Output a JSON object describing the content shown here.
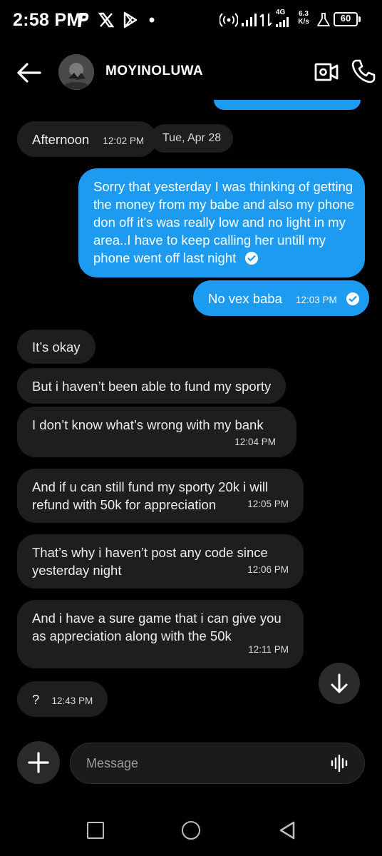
{
  "status_bar": {
    "time": "2:58 PM",
    "notification_icons": [
      "paypal-p-icon",
      "x-icon",
      "play-store-icon",
      "dot-icon"
    ],
    "network_label": "4G",
    "speed_value": "6.3",
    "speed_unit": "K/s",
    "battery": "60"
  },
  "header": {
    "contact_name": "MOYINOLUWA"
  },
  "messages": [
    {
      "text": "Afternoon",
      "time": "12:02 PM"
    },
    {
      "text": "Tue, Apr 28"
    },
    {
      "text": "Sorry that yesterday I was thinking of getting the money from my babe and also my phone don off it's was really low and no light in my area..I have to keep calling her untill my phone went off last night"
    },
    {
      "text": "No vex baba",
      "time": "12:03 PM"
    },
    {
      "text": "It’s okay"
    },
    {
      "text": "But i haven’t been able to fund my sporty"
    },
    {
      "text": "I don’t know what’s wrong with my bank",
      "time": "12:04 PM"
    },
    {
      "text": "And if u can still fund my sporty 20k i will refund with 50k for appreciation",
      "time": "12:05 PM"
    },
    {
      "text": "That’s why i haven’t post any code since yesterday night",
      "time": "12:06 PM"
    },
    {
      "text": "And i have a sure game that i can give you as appreciation along with the 50k",
      "time": "12:11 PM"
    },
    {
      "text": "?",
      "time": "12:43 PM"
    }
  ],
  "composer": {
    "placeholder": "Message"
  },
  "colors": {
    "outgoing_bubble": "#1d9bf0",
    "incoming_bubble": "#1e1e1e",
    "background": "#000000"
  }
}
